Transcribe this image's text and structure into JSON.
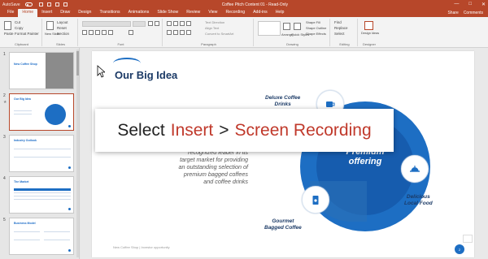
{
  "titlebar": {
    "autosave_label": "AutoSave",
    "doc_title": "Coffee Pitch Content 01 - Read-Only",
    "win_min": "—",
    "win_max": "□",
    "win_close": "✕"
  },
  "tabs": [
    {
      "label": "File"
    },
    {
      "label": "Home"
    },
    {
      "label": "Insert"
    },
    {
      "label": "Draw"
    },
    {
      "label": "Design"
    },
    {
      "label": "Transitions"
    },
    {
      "label": "Animations"
    },
    {
      "label": "Slide Show"
    },
    {
      "label": "Review"
    },
    {
      "label": "View"
    },
    {
      "label": "Recording"
    },
    {
      "label": "Add-ins"
    },
    {
      "label": "Help"
    }
  ],
  "tab_right": {
    "share": "Share",
    "comments": "Comments"
  },
  "ribbon": {
    "clipboard": {
      "label": "Clipboard",
      "paste": "Paste",
      "cut": "Cut",
      "copy": "Copy",
      "format_painter": "Format Painter"
    },
    "slides": {
      "label": "Slides",
      "new_slide": "New Slide",
      "layout": "Layout",
      "reset": "Reset",
      "section": "Section"
    },
    "font": {
      "label": "Font"
    },
    "paragraph": {
      "label": "Paragraph",
      "text_direction": "Text Direction",
      "align_text": "Align Text",
      "convert": "Convert to SmartArt"
    },
    "drawing": {
      "label": "Drawing",
      "arrange": "Arrange",
      "quick_styles": "Quick Styles",
      "shape_fill": "Shape Fill",
      "shape_outline": "Shape Outline",
      "shape_effects": "Shape Effects"
    },
    "editing": {
      "label": "Editing",
      "find": "Find",
      "replace": "Replace",
      "select": "Select"
    },
    "designer": {
      "label": "Designer",
      "design_ideas": "Design Ideas"
    }
  },
  "slides_pane": [
    {
      "num": "1",
      "title": "New Coffee Shop",
      "selected": false
    },
    {
      "num": "2",
      "title": "Our Big Idea",
      "selected": true
    },
    {
      "num": "3",
      "title": "Industry Outlook",
      "selected": false
    },
    {
      "num": "4",
      "title": "The Market",
      "selected": false
    },
    {
      "num": "5",
      "title": "Business Model",
      "selected": false
    }
  ],
  "slide": {
    "title": "Our Big Idea",
    "body_lines": [
      "recognized leader in its",
      "target market for providing",
      "an outstanding selection of",
      "premium bagged coffees",
      "and coffee drinks"
    ],
    "center_label_1": "Premium",
    "center_label_2": "offering",
    "features": [
      {
        "label_1": "Deluxe Coffee",
        "label_2": "Drinks",
        "icon": "coffee-cup-icon"
      },
      {
        "label_1": "Delicious",
        "label_2": "Local Food",
        "icon": "food-cloche-icon"
      },
      {
        "label_1": "Gourmet",
        "label_2": "Bagged Coffee",
        "icon": "coffee-bag-icon"
      }
    ],
    "footer": "New Coffee Shop   |   Investor opportunity",
    "page_number": "2"
  },
  "overlay": {
    "word1": "Select",
    "word2": "Insert",
    "separator": ">",
    "word3": "Screen Recording"
  },
  "colors": {
    "accent": "#b7472a",
    "brand_blue": "#1d6ec3",
    "highlight_red": "#c0392b"
  }
}
